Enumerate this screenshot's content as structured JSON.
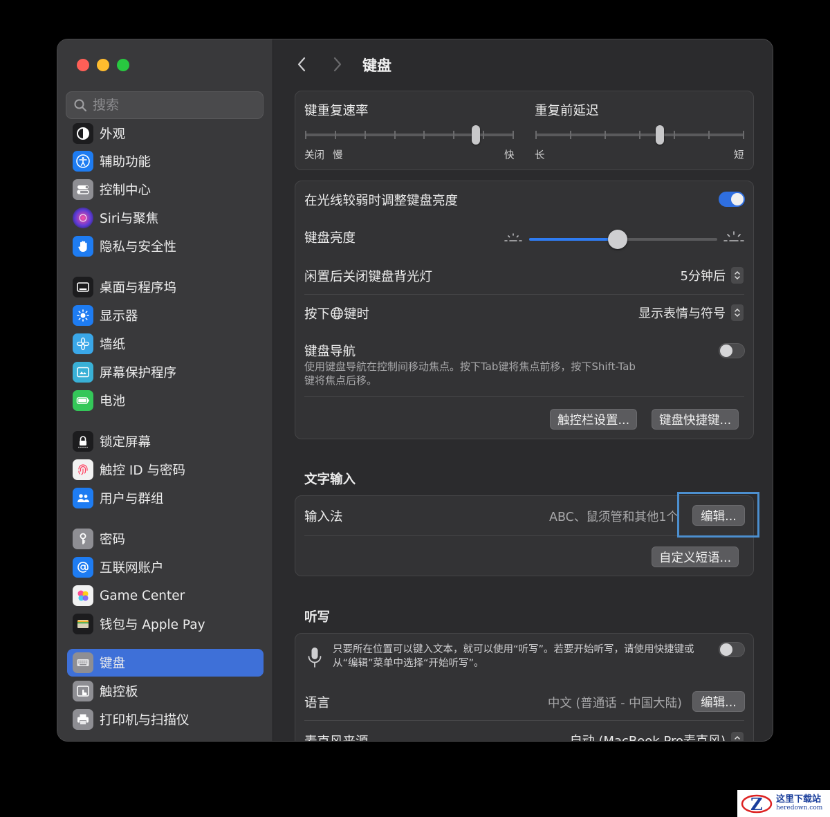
{
  "window": {
    "search": {
      "placeholder": "搜索"
    },
    "sidebar": {
      "items": [
        {
          "label": "外观",
          "icon": "appearance-icon",
          "color": "#1c1c1e"
        },
        {
          "label": "辅助功能",
          "icon": "accessibility-icon",
          "color": "#1e7cf2"
        },
        {
          "label": "控制中心",
          "icon": "control-center-icon",
          "color": "#8e8e93"
        },
        {
          "label": "Siri与聚焦",
          "icon": "siri-icon",
          "color": "#5b3bd6"
        },
        {
          "label": "隐私与安全性",
          "icon": "privacy-hand-icon",
          "color": "#1e7cf2"
        },
        {
          "label": "桌面与程序坞",
          "icon": "desktop-dock-icon",
          "color": "#1c1c1e"
        },
        {
          "label": "显示器",
          "icon": "display-sun-icon",
          "color": "#1e7cf2"
        },
        {
          "label": "墙纸",
          "icon": "wallpaper-flower-icon",
          "color": "#3aa7e8"
        },
        {
          "label": "屏幕保护程序",
          "icon": "screensaver-icon",
          "color": "#39b0d6"
        },
        {
          "label": "电池",
          "icon": "battery-icon",
          "color": "#34c759"
        },
        {
          "label": "锁定屏幕",
          "icon": "lock-icon",
          "color": "#1c1c1e"
        },
        {
          "label": "触控 ID 与密码",
          "icon": "fingerprint-icon",
          "color": "#f2f2f2"
        },
        {
          "label": "用户与群组",
          "icon": "users-icon",
          "color": "#1e7cf2"
        },
        {
          "label": "密码",
          "icon": "key-icon",
          "color": "#8e8e93"
        },
        {
          "label": "互联网账户",
          "icon": "at-sign-icon",
          "color": "#1e7cf2"
        },
        {
          "label": "Game Center",
          "icon": "game-center-icon",
          "color": "#f2f2f2"
        },
        {
          "label": "钱包与 Apple Pay",
          "icon": "wallet-icon",
          "color": "#1c1c1e"
        },
        {
          "label": "键盘",
          "icon": "keyboard-icon",
          "color": "#8e8e93"
        },
        {
          "label": "触控板",
          "icon": "trackpad-icon",
          "color": "#8e8e93"
        },
        {
          "label": "打印机与扫描仪",
          "icon": "printer-icon",
          "color": "#8e8e93"
        }
      ],
      "active": "键盘"
    },
    "main": {
      "title": "键盘",
      "repeat": {
        "rate_label": "键重复速率",
        "rate_left_a": "关闭",
        "rate_left_b": "慢",
        "rate_right": "快",
        "rate_value": 0.83,
        "delay_label": "重复前延迟",
        "delay_left": "长",
        "delay_right": "短",
        "delay_value": 0.6
      },
      "brightness": {
        "auto_label": "在光线较弱时调整键盘亮度",
        "auto_on": true,
        "level_label": "键盘亮度",
        "level_value": 0.47,
        "backlight_label": "闲置后关闭键盘背光灯",
        "backlight_value": "5分钟后",
        "globe_label_a": "按下",
        "globe_label_b": "键时",
        "globe_value": "显示表情与符号",
        "nav_label": "键盘导航",
        "nav_desc_1": "使用键盘导航在控制间移动焦点。按下Tab键将焦点前移，按下Shift-Tab",
        "nav_desc_2": "键将焦点后移。",
        "nav_on": false,
        "touchbar_btn": "触控栏设置...",
        "shortcuts_btn": "键盘快捷键..."
      },
      "text_input": {
        "section_title": "文字输入",
        "input_label": "输入法",
        "input_value": "ABC、鼠须管和其他1个",
        "edit_btn": "编辑...",
        "phrases_btn": "自定义短语..."
      },
      "dictation": {
        "section_title": "听写",
        "desc_1": "只要所在位置可以键入文本，就可以使用“听写”。若要开始听写，请使用快捷键或",
        "desc_2": "从“编辑”菜单中选择“开始听写”。",
        "on": false,
        "language_label": "语言",
        "language_value": "中文 (普通话 - 中国大陆)",
        "language_edit_btn": "编辑...",
        "mic_label": "麦克风来源",
        "mic_value": "自动 (MacBook Pro麦克风)"
      }
    }
  },
  "watermark": {
    "cn": "这里下载站",
    "en": "heredown.com"
  }
}
